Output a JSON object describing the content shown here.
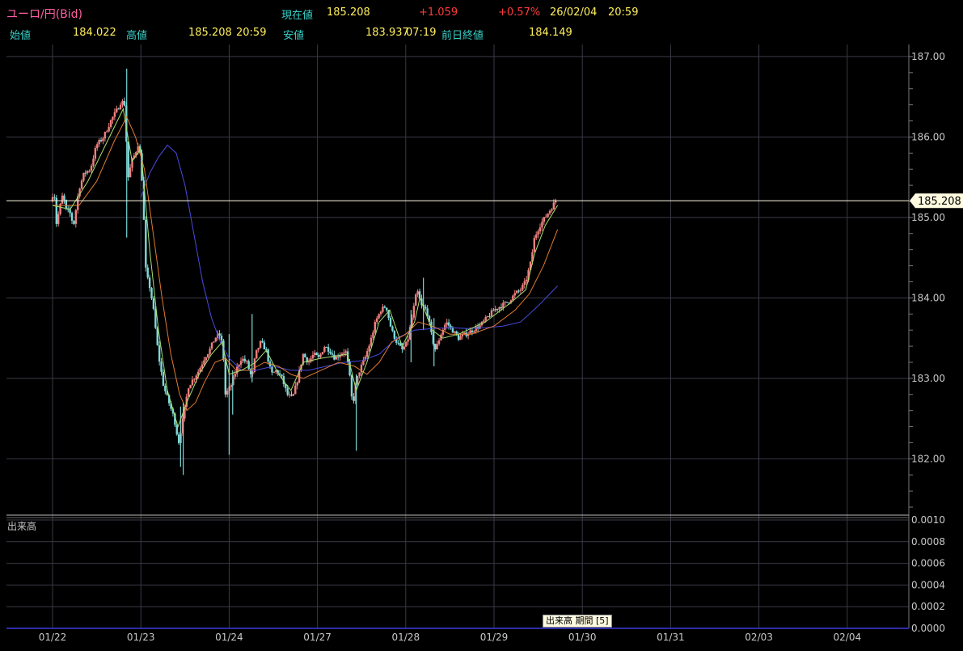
{
  "header": {
    "pair": "ユーロ/円(Bid)",
    "current_label": "現在値",
    "current_value": "185.208",
    "change": "+1.059",
    "change_pct": "+0.57%",
    "date": "26/02/04",
    "time": "20:59",
    "open_label": "始値",
    "open_value": "184.022",
    "high_label": "高値",
    "high_value": "185.208",
    "high_time": "20:59",
    "low_label": "安値",
    "low_value": "183.937",
    "low_time": "07:19",
    "prev_close_label": "前日終値",
    "prev_close_value": "184.149"
  },
  "volume_panel": {
    "label": "出来高",
    "legend": "出来高 期間 [5]",
    "ticks": [
      "0.0010",
      "0.0008",
      "0.0006",
      "0.0004",
      "0.0002",
      "0.0000"
    ]
  },
  "colors": {
    "up": "#f08080",
    "down": "#7fd8d8",
    "ma_short": "#a8e070",
    "ma_mid": "#e07a30",
    "ma_long": "#4a4ae0",
    "current_line": "#fffbe0",
    "grid": "#3a3a48",
    "axis_text": "#c8c8c8"
  },
  "chart_data": {
    "type": "candlestick",
    "ylim": [
      181.3,
      187.15
    ],
    "yticks": [
      "187.00",
      "186.00",
      "185.00",
      "184.00",
      "183.00",
      "182.00"
    ],
    "dates": [
      "01/22",
      "01/23",
      "01/24",
      "01/27",
      "01/28",
      "01/29",
      "01/30",
      "01/31",
      "02/03",
      "02/04"
    ],
    "current_price": "185.208",
    "anchors": [
      [
        0.0,
        185.2
      ],
      [
        0.04,
        185.35
      ],
      [
        0.06,
        184.9
      ],
      [
        0.1,
        185.1
      ],
      [
        0.14,
        185.3
      ],
      [
        0.17,
        185.1
      ],
      [
        0.22,
        185.05
      ],
      [
        0.26,
        184.9
      ],
      [
        0.32,
        185.35
      ],
      [
        0.38,
        185.55
      ],
      [
        0.45,
        185.6
      ],
      [
        0.52,
        185.9
      ],
      [
        0.6,
        186.0
      ],
      [
        0.68,
        186.2
      ],
      [
        0.76,
        186.35
      ],
      [
        0.8,
        186.45
      ],
      [
        0.84,
        186.4
      ],
      [
        0.86,
        185.9
      ],
      [
        0.88,
        185.5
      ],
      [
        0.92,
        185.7
      ],
      [
        0.96,
        185.8
      ],
      [
        1.0,
        185.95
      ],
      [
        1.04,
        185.4
      ],
      [
        1.08,
        184.3
      ],
      [
        1.12,
        184.15
      ],
      [
        1.16,
        183.9
      ],
      [
        1.22,
        183.3
      ],
      [
        1.28,
        182.9
      ],
      [
        1.34,
        182.7
      ],
      [
        1.4,
        182.5
      ],
      [
        1.45,
        182.2
      ],
      [
        1.5,
        182.5
      ],
      [
        1.56,
        182.9
      ],
      [
        1.62,
        183.0
      ],
      [
        1.68,
        183.1
      ],
      [
        1.74,
        183.25
      ],
      [
        1.8,
        183.35
      ],
      [
        1.86,
        183.5
      ],
      [
        1.91,
        183.55
      ],
      [
        1.95,
        183.4
      ],
      [
        1.98,
        182.8
      ],
      [
        2.04,
        182.9
      ],
      [
        2.1,
        183.1
      ],
      [
        2.16,
        183.25
      ],
      [
        2.22,
        183.2
      ],
      [
        2.28,
        183.0
      ],
      [
        2.32,
        183.3
      ],
      [
        2.38,
        183.45
      ],
      [
        2.44,
        183.35
      ],
      [
        2.5,
        183.05
      ],
      [
        2.56,
        183.1
      ],
      [
        2.62,
        183.0
      ],
      [
        2.68,
        182.8
      ],
      [
        2.74,
        182.75
      ],
      [
        2.8,
        183.0
      ],
      [
        2.86,
        183.3
      ],
      [
        2.92,
        183.2
      ],
      [
        2.98,
        183.3
      ],
      [
        3.04,
        183.25
      ],
      [
        3.1,
        183.4
      ],
      [
        3.16,
        183.35
      ],
      [
        3.22,
        183.25
      ],
      [
        3.28,
        183.3
      ],
      [
        3.34,
        183.35
      ],
      [
        3.38,
        183.1
      ],
      [
        3.42,
        182.65
      ],
      [
        3.46,
        182.95
      ],
      [
        3.5,
        183.1
      ],
      [
        3.56,
        183.25
      ],
      [
        3.62,
        183.45
      ],
      [
        3.68,
        183.7
      ],
      [
        3.74,
        183.85
      ],
      [
        3.8,
        183.9
      ],
      [
        3.86,
        183.6
      ],
      [
        3.92,
        183.45
      ],
      [
        3.98,
        183.35
      ],
      [
        4.04,
        183.45
      ],
      [
        4.1,
        183.8
      ],
      [
        4.15,
        184.1
      ],
      [
        4.2,
        183.9
      ],
      [
        4.26,
        183.85
      ],
      [
        4.32,
        183.5
      ],
      [
        4.36,
        183.35
      ],
      [
        4.42,
        183.55
      ],
      [
        4.48,
        183.7
      ],
      [
        4.55,
        183.6
      ],
      [
        4.62,
        183.5
      ],
      [
        4.7,
        183.55
      ],
      [
        4.78,
        183.6
      ],
      [
        4.86,
        183.65
      ],
      [
        4.94,
        183.75
      ],
      [
        5.02,
        183.85
      ],
      [
        5.1,
        183.9
      ],
      [
        5.18,
        183.95
      ],
      [
        5.26,
        184.05
      ],
      [
        5.32,
        184.1
      ],
      [
        5.38,
        184.2
      ],
      [
        5.44,
        184.45
      ],
      [
        5.48,
        184.75
      ],
      [
        5.54,
        184.9
      ],
      [
        5.6,
        185.0
      ],
      [
        5.66,
        185.1
      ],
      [
        5.72,
        185.208
      ]
    ],
    "ma_short": [
      [
        0.0,
        185.15
      ],
      [
        0.2,
        185.1
      ],
      [
        0.4,
        185.45
      ],
      [
        0.6,
        185.9
      ],
      [
        0.8,
        186.35
      ],
      [
        0.9,
        185.7
      ],
      [
        1.0,
        185.85
      ],
      [
        1.1,
        184.6
      ],
      [
        1.2,
        183.6
      ],
      [
        1.3,
        182.85
      ],
      [
        1.42,
        182.4
      ],
      [
        1.52,
        182.7
      ],
      [
        1.66,
        183.05
      ],
      [
        1.8,
        183.3
      ],
      [
        1.92,
        183.45
      ],
      [
        2.0,
        183.05
      ],
      [
        2.14,
        183.1
      ],
      [
        2.3,
        183.2
      ],
      [
        2.42,
        183.35
      ],
      [
        2.56,
        183.05
      ],
      [
        2.7,
        182.85
      ],
      [
        2.84,
        183.2
      ],
      [
        3.04,
        183.25
      ],
      [
        3.22,
        183.28
      ],
      [
        3.34,
        183.3
      ],
      [
        3.44,
        182.85
      ],
      [
        3.56,
        183.2
      ],
      [
        3.7,
        183.7
      ],
      [
        3.82,
        183.85
      ],
      [
        3.96,
        183.4
      ],
      [
        4.1,
        183.7
      ],
      [
        4.16,
        184.0
      ],
      [
        4.3,
        183.6
      ],
      [
        4.42,
        183.5
      ],
      [
        4.6,
        183.55
      ],
      [
        4.9,
        183.7
      ],
      [
        5.2,
        183.95
      ],
      [
        5.36,
        184.1
      ],
      [
        5.46,
        184.55
      ],
      [
        5.58,
        184.9
      ],
      [
        5.72,
        185.15
      ]
    ],
    "ma_mid": [
      [
        0.0,
        185.15
      ],
      [
        0.3,
        185.15
      ],
      [
        0.5,
        185.45
      ],
      [
        0.7,
        185.95
      ],
      [
        0.84,
        186.25
      ],
      [
        0.94,
        186.0
      ],
      [
        1.04,
        185.6
      ],
      [
        1.14,
        184.8
      ],
      [
        1.24,
        184.0
      ],
      [
        1.34,
        183.3
      ],
      [
        1.44,
        182.8
      ],
      [
        1.52,
        182.6
      ],
      [
        1.62,
        182.7
      ],
      [
        1.72,
        182.95
      ],
      [
        1.84,
        183.2
      ],
      [
        1.96,
        183.25
      ],
      [
        2.08,
        183.1
      ],
      [
        2.24,
        183.1
      ],
      [
        2.4,
        183.2
      ],
      [
        2.56,
        183.15
      ],
      [
        2.7,
        183.05
      ],
      [
        2.84,
        183.0
      ],
      [
        3.04,
        183.1
      ],
      [
        3.24,
        183.2
      ],
      [
        3.42,
        183.15
      ],
      [
        3.56,
        183.05
      ],
      [
        3.7,
        183.2
      ],
      [
        3.84,
        183.45
      ],
      [
        4.0,
        183.55
      ],
      [
        4.14,
        183.7
      ],
      [
        4.3,
        183.65
      ],
      [
        4.5,
        183.55
      ],
      [
        4.74,
        183.55
      ],
      [
        5.0,
        183.65
      ],
      [
        5.24,
        183.85
      ],
      [
        5.4,
        184.05
      ],
      [
        5.56,
        184.4
      ],
      [
        5.72,
        184.85
      ]
    ],
    "ma_long": [
      [
        1.0,
        185.25
      ],
      [
        1.1,
        185.55
      ],
      [
        1.2,
        185.75
      ],
      [
        1.3,
        185.9
      ],
      [
        1.4,
        185.8
      ],
      [
        1.5,
        185.4
      ],
      [
        1.6,
        184.8
      ],
      [
        1.7,
        184.2
      ],
      [
        1.8,
        183.75
      ],
      [
        1.9,
        183.45
      ],
      [
        2.0,
        183.25
      ],
      [
        2.14,
        183.1
      ],
      [
        2.3,
        183.1
      ],
      [
        2.5,
        183.15
      ],
      [
        2.7,
        183.1
      ],
      [
        2.9,
        183.1
      ],
      [
        3.1,
        183.15
      ],
      [
        3.3,
        183.2
      ],
      [
        3.5,
        183.22
      ],
      [
        3.7,
        183.3
      ],
      [
        3.9,
        183.5
      ],
      [
        4.1,
        183.6
      ],
      [
        4.3,
        183.62
      ],
      [
        4.5,
        183.63
      ],
      [
        4.7,
        183.62
      ],
      [
        4.9,
        183.63
      ],
      [
        5.1,
        183.65
      ],
      [
        5.3,
        183.7
      ],
      [
        5.5,
        183.9
      ],
      [
        5.72,
        184.15
      ]
    ],
    "spikes": [
      [
        0.84,
        184.75,
        186.85
      ],
      [
        1.45,
        181.9,
        182.65
      ],
      [
        1.48,
        181.8,
        182.7
      ],
      [
        2.0,
        182.05,
        183.55
      ],
      [
        2.04,
        182.55,
        183.1
      ],
      [
        2.26,
        182.95,
        183.8
      ],
      [
        3.44,
        182.1,
        183.05
      ],
      [
        4.06,
        183.2,
        183.85
      ],
      [
        4.2,
        183.6,
        184.25
      ],
      [
        4.32,
        183.15,
        183.75
      ]
    ]
  }
}
